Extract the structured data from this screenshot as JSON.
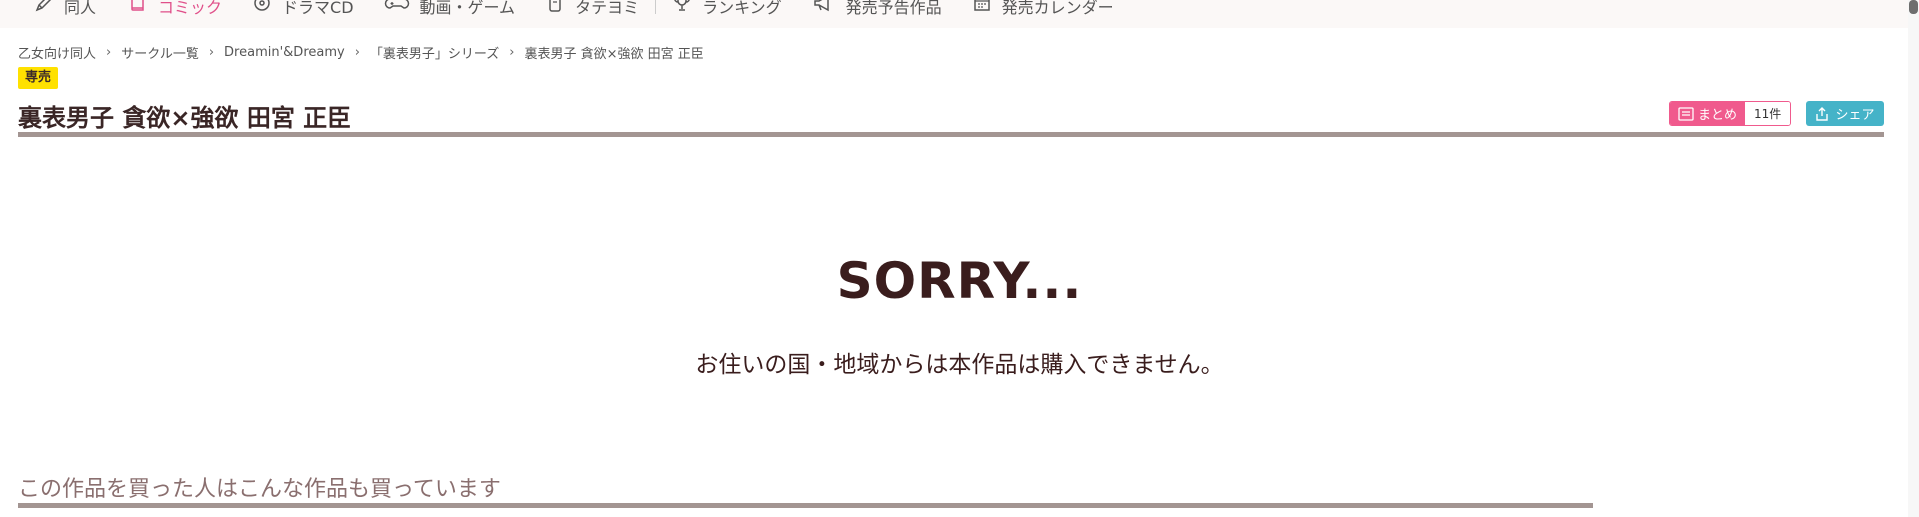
{
  "nav": {
    "items": [
      {
        "label": "同人",
        "icon": "pen-icon",
        "active": false
      },
      {
        "label": "コミック",
        "icon": "book-icon",
        "active": true
      },
      {
        "label": "ドラマCD",
        "icon": "cd-icon",
        "active": false
      },
      {
        "label": "動画・ゲーム",
        "icon": "gamepad-icon",
        "active": false
      },
      {
        "label": "タテヨミ",
        "icon": "phone-icon",
        "active": false
      },
      {
        "label": "ランキング",
        "icon": "trophy-icon",
        "active": false
      },
      {
        "label": "発売予告作品",
        "icon": "megaphone-icon",
        "active": false
      },
      {
        "label": "発売カレンダー",
        "icon": "calendar-icon",
        "active": false
      }
    ]
  },
  "breadcrumb": [
    "乙女向け同人",
    "サークル一覧",
    "Dreamin'&Dreamy",
    "「裏表男子」シリーズ",
    "裏表男子 貪欲×強欲 田宮 正臣"
  ],
  "product": {
    "badge": "専売",
    "title": "裏表男子 貪欲×強欲 田宮 正臣"
  },
  "actions": {
    "matome_label": "まとめ",
    "matome_count": "11件",
    "share_label": "シェア"
  },
  "error": {
    "heading": "SORRY...",
    "message": "お住いの国・地域からは本作品は購入できません。"
  },
  "recommend": {
    "heading": "この作品を買った人はこんな作品も買っています"
  },
  "colors": {
    "accent_pink": "#f05a8d",
    "share_teal": "#45b3c8",
    "badge_yellow": "#ffe100",
    "rule_gray": "#a39592"
  }
}
